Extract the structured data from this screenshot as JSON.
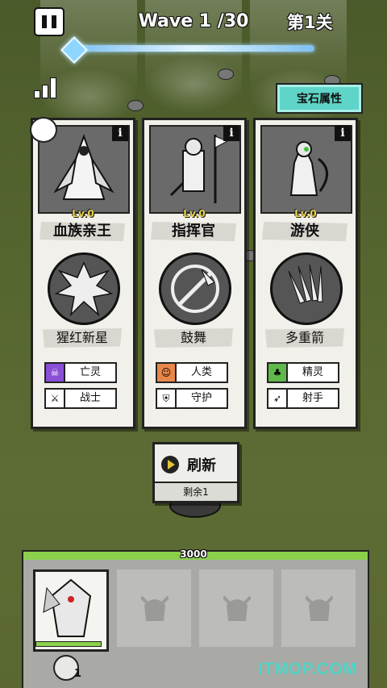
{
  "top_bar": {
    "wave_label": "Wave  1 /30",
    "level_label": "第1关",
    "pause_icon": "pause-icon",
    "stats_icon": "bar-chart-icon",
    "gem_attr_button": "宝石属性"
  },
  "cards": [
    {
      "level": "Lv.0",
      "name": "血族亲王",
      "skill": "猩红新星",
      "tags": [
        {
          "label": "亡灵",
          "icon": "undead-icon",
          "color": "#8a4fd6"
        },
        {
          "label": "战士",
          "icon": "warrior-icon",
          "color": "#ffffff"
        }
      ]
    },
    {
      "level": "Lv.0",
      "name": "指挥官",
      "skill": "鼓舞",
      "tags": [
        {
          "label": "人类",
          "icon": "human-icon",
          "color": "#e8874a"
        },
        {
          "label": "守护",
          "icon": "shield-icon",
          "color": "#ffffff"
        }
      ]
    },
    {
      "level": "Lv.0",
      "name": "游侠",
      "skill": "多重箭",
      "tags": [
        {
          "label": "精灵",
          "icon": "elf-icon",
          "color": "#5fb84a"
        },
        {
          "label": "射手",
          "icon": "archer-icon",
          "color": "#ffffff"
        }
      ]
    }
  ],
  "refresh": {
    "label": "刷新",
    "remaining": "剩余1"
  },
  "base_hp": "3000",
  "hero_slots": {
    "ball_count": "1"
  },
  "watermark": "ITMOP.COM"
}
